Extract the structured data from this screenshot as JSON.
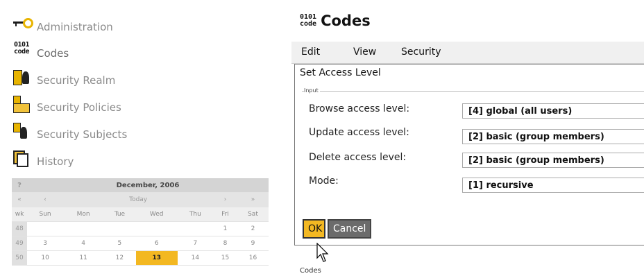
{
  "nav": {
    "items": [
      {
        "label": "Administration",
        "icon": "key-icon"
      },
      {
        "label": "Codes",
        "icon": "code-icon"
      },
      {
        "label": "Security Realm",
        "icon": "security-realm-icon"
      },
      {
        "label": "Security Policies",
        "icon": "security-policies-icon"
      },
      {
        "label": "Security Subjects",
        "icon": "security-subjects-icon"
      },
      {
        "label": "History",
        "icon": "history-icon"
      }
    ],
    "code_glyph_top": "0101",
    "code_glyph_bottom": "code"
  },
  "calendar": {
    "help": "?",
    "month": "December, 2006",
    "prev_year": "«",
    "prev_month": "‹",
    "today": "Today",
    "next_month": "›",
    "next_year": "»",
    "weekdays": [
      "wk",
      "Sun",
      "Mon",
      "Tue",
      "Wed",
      "Thu",
      "Fri",
      "Sat"
    ],
    "weeks": [
      [
        "48",
        "",
        "",
        "",
        "",
        "",
        "1",
        "2"
      ],
      [
        "49",
        "3",
        "4",
        "5",
        "6",
        "7",
        "8",
        "9"
      ],
      [
        "50",
        "10",
        "11",
        "12",
        "13",
        "14",
        "15",
        "16"
      ]
    ],
    "selected": "13"
  },
  "page": {
    "title": "Codes",
    "menu": [
      "Edit",
      "View",
      "Security"
    ]
  },
  "dialog": {
    "title": "Set Access Level",
    "legend": "Input",
    "rows": [
      {
        "label": "Browse access level:",
        "value": "[4] global (all users)"
      },
      {
        "label": "Update access level:",
        "value": "[2] basic (group members)"
      },
      {
        "label": "Delete access level:",
        "value": "[2] basic (group members)"
      },
      {
        "label": "Mode:",
        "value": "[1] recursive"
      }
    ],
    "ok": "OK",
    "cancel": "Cancel"
  },
  "footer": {
    "label": "Codes"
  },
  "colors": {
    "accent": "#f3b822",
    "icon_gold": "#e8b400"
  }
}
